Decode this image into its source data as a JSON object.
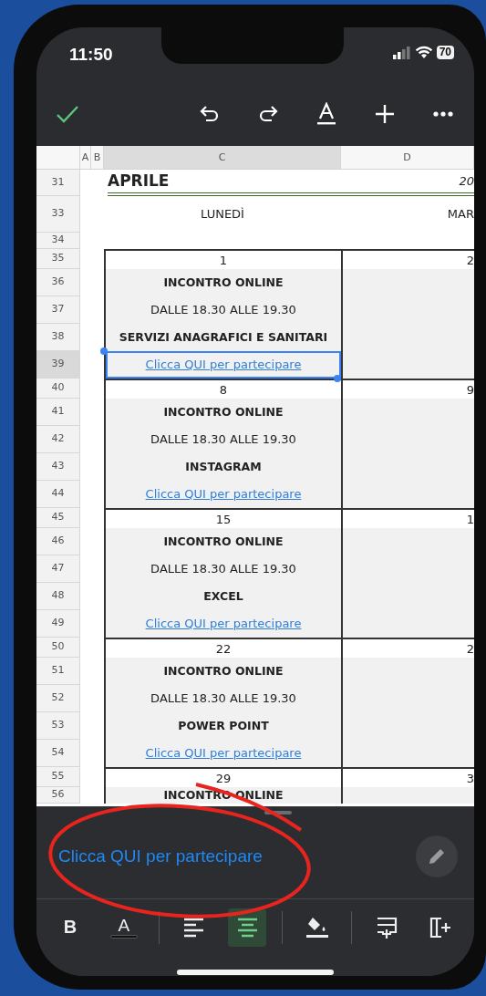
{
  "status_bar": {
    "time": "11:50",
    "battery": "70"
  },
  "column_headers": [
    {
      "label": "A",
      "selected": false
    },
    {
      "label": "B",
      "selected": false
    },
    {
      "label": "C",
      "selected": true
    },
    {
      "label": "D",
      "selected": false
    }
  ],
  "rows": [
    {
      "number": "31",
      "kind": "title",
      "c": "APRILE",
      "d": "20",
      "selected": false
    },
    {
      "number": "33",
      "kind": "weekday",
      "c": "LUNEDÌ",
      "d": "MAR",
      "selected": false
    },
    {
      "number": "34",
      "kind": "blank",
      "selected": false
    },
    {
      "number": "35",
      "kind": "date",
      "c": "1",
      "d": "2",
      "selected": false
    },
    {
      "number": "36",
      "kind": "bold",
      "c": "INCONTRO ONLINE",
      "selected": false
    },
    {
      "number": "37",
      "kind": "plain",
      "c": "DALLE 18.30 ALLE 19.30",
      "selected": false
    },
    {
      "number": "38",
      "kind": "bold",
      "c": "SERVIZI ANAGRAFICI E SANITARI",
      "selected": false
    },
    {
      "number": "39",
      "kind": "link",
      "c": "Clicca QUI per partecipare",
      "selected": true
    },
    {
      "number": "40",
      "kind": "date",
      "c": "8",
      "d": "9",
      "selected": false
    },
    {
      "number": "41",
      "kind": "bold",
      "c": "INCONTRO ONLINE",
      "selected": false
    },
    {
      "number": "42",
      "kind": "plain",
      "c": "DALLE 18.30 ALLE 19.30",
      "selected": false
    },
    {
      "number": "43",
      "kind": "bold",
      "c": "INSTAGRAM",
      "selected": false
    },
    {
      "number": "44",
      "kind": "link",
      "c": "Clicca QUI per partecipare",
      "selected": false
    },
    {
      "number": "45",
      "kind": "date",
      "c": "15",
      "d": "1",
      "selected": false
    },
    {
      "number": "46",
      "kind": "bold",
      "c": "INCONTRO ONLINE",
      "selected": false
    },
    {
      "number": "47",
      "kind": "plain",
      "c": "DALLE 18.30 ALLE 19.30",
      "selected": false
    },
    {
      "number": "48",
      "kind": "bold",
      "c": "EXCEL",
      "selected": false
    },
    {
      "number": "49",
      "kind": "link",
      "c": "Clicca QUI per partecipare",
      "selected": false
    },
    {
      "number": "50",
      "kind": "date",
      "c": "22",
      "d": "2",
      "selected": false
    },
    {
      "number": "51",
      "kind": "bold",
      "c": "INCONTRO ONLINE",
      "selected": false
    },
    {
      "number": "52",
      "kind": "plain",
      "c": "DALLE 18.30 ALLE 19.30",
      "selected": false
    },
    {
      "number": "53",
      "kind": "bold",
      "c": "POWER POINT",
      "selected": false
    },
    {
      "number": "54",
      "kind": "link",
      "c": "Clicca QUI per partecipare",
      "selected": false
    },
    {
      "number": "55",
      "kind": "date",
      "c": "29",
      "d": "3",
      "selected": false
    },
    {
      "number": "56",
      "kind": "bold",
      "c": "INCONTRO ONLINE",
      "selected": false
    }
  ],
  "cell_editor": {
    "value": "Clicca QUI per partecipare"
  },
  "format_bar": {
    "bold_label": "B",
    "text_color_label": "A",
    "alignment": [
      {
        "kind": "left",
        "selected": false
      },
      {
        "kind": "center",
        "selected": true
      }
    ]
  }
}
